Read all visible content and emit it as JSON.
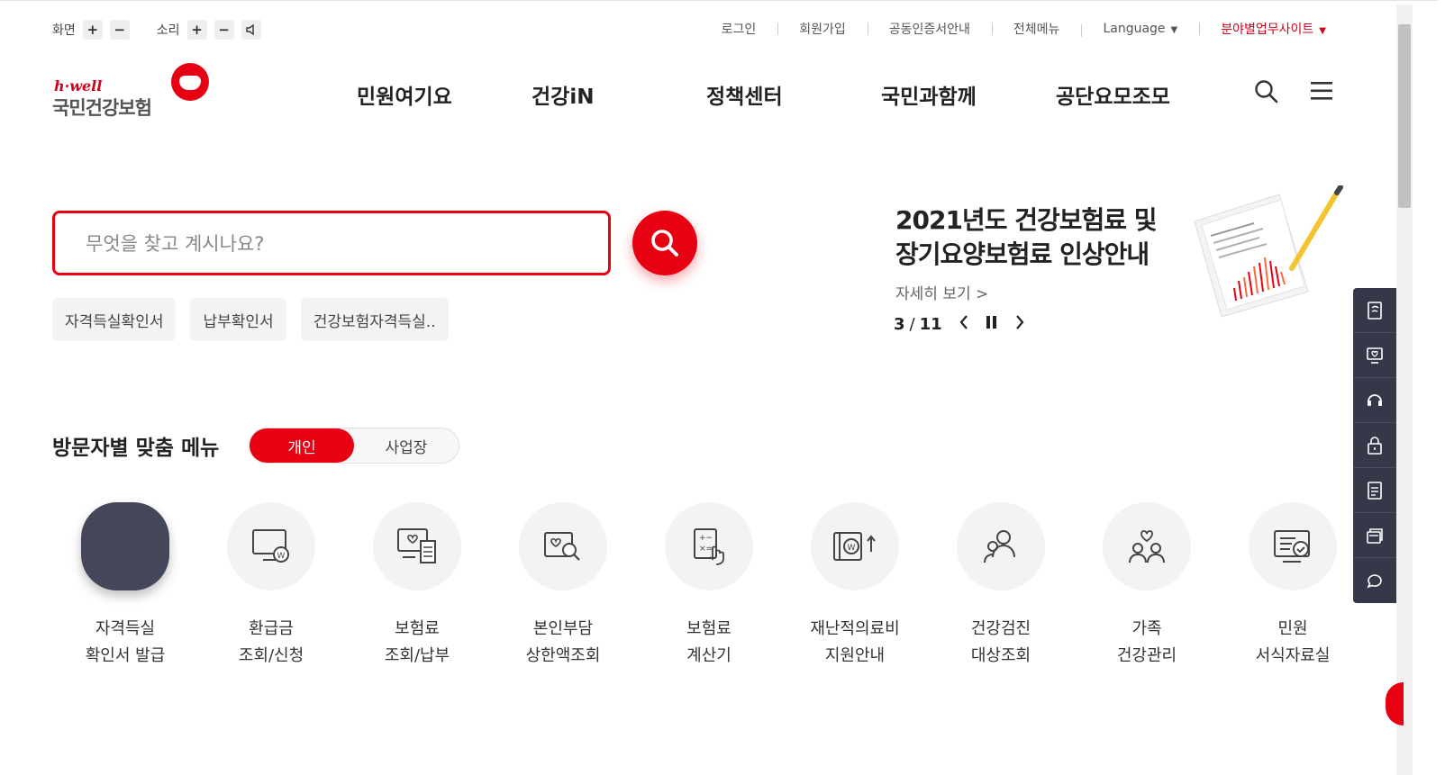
{
  "utility": {
    "screen_label": "화면",
    "sound_label": "소리",
    "plus": "+",
    "minus": "−",
    "links": [
      "로그인",
      "회원가입",
      "공동인증서안내",
      "전체메뉴",
      "Language"
    ],
    "field_sites": "분야별업무사이트"
  },
  "logo": {
    "tagline": "h·well",
    "name": "국민건강보험"
  },
  "nav": [
    "민원여기요",
    "건강iN",
    "정책센터",
    "국민과함께",
    "공단요모조모"
  ],
  "search": {
    "placeholder": "무엇을 찾고 계시나요?",
    "chips": [
      "자격득실확인서",
      "납부확인서",
      "건강보험자격득실.."
    ]
  },
  "banner": {
    "title_line1": "2021년도 건강보험료 및",
    "title_line2": "장기요양보험료 인상안내",
    "more": "자세히 보기 >",
    "current": "3",
    "total": "11"
  },
  "visitor_menu": {
    "title": "방문자별 맞춤 메뉴",
    "options": [
      "개인",
      "사업장"
    ],
    "items": [
      {
        "line1": "자격득실",
        "line2": "확인서 발급",
        "icon": "certificate-icon"
      },
      {
        "line1": "환급금",
        "line2": "조회/신청",
        "icon": "refund-monitor-icon"
      },
      {
        "line1": "보험료",
        "line2": "조회/납부",
        "icon": "premium-payment-icon"
      },
      {
        "line1": "본인부담",
        "line2": "상한액조회",
        "icon": "heart-search-icon"
      },
      {
        "line1": "보험료",
        "line2": "계산기",
        "icon": "calculator-icon"
      },
      {
        "line1": "재난적의료비",
        "line2": "지원안내",
        "icon": "medical-support-icon"
      },
      {
        "line1": "건강검진",
        "line2": "대상조회",
        "icon": "checkup-people-icon"
      },
      {
        "line1": "가족",
        "line2": "건강관리",
        "icon": "family-health-icon"
      },
      {
        "line1": "민원",
        "line2": "서식자료실",
        "icon": "form-library-icon"
      }
    ]
  },
  "colors": {
    "accent": "#e60012",
    "sidebar": "#36384a",
    "dark_tile": "#44465a"
  }
}
